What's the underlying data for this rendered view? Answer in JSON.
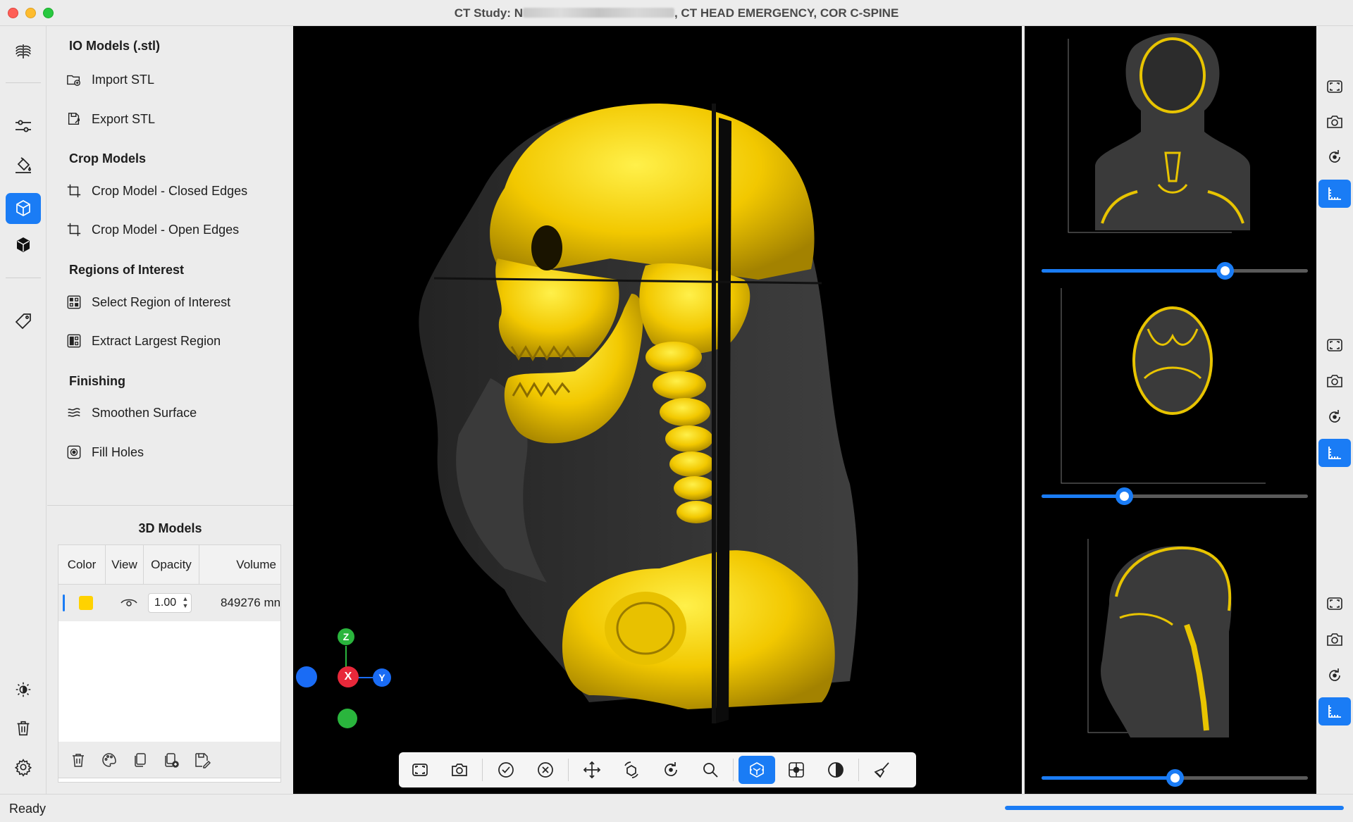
{
  "window": {
    "title_prefix": "CT Study: N",
    "title_suffix": ", CT  HEAD EMERGENCY, COR C-SPINE"
  },
  "tools": {
    "io_header": "IO Models (.stl)",
    "import_stl": "Import STL",
    "export_stl": "Export STL",
    "crop_header": "Crop Models",
    "crop_closed": "Crop Model - Closed Edges",
    "crop_open": "Crop Model - Open Edges",
    "roi_header": "Regions of Interest",
    "select_roi": "Select Region of Interest",
    "extract_largest": "Extract Largest Region",
    "finishing_header": "Finishing",
    "smoothen": "Smoothen Surface",
    "fill_holes": "Fill Holes"
  },
  "models": {
    "title": "3D Models",
    "columns": [
      "Color",
      "View",
      "Opacity",
      "Volume"
    ],
    "rows": [
      {
        "color": "#ffd200",
        "opacity": "1.00",
        "volume": "849276 mn"
      }
    ]
  },
  "axes": {
    "z": "Z",
    "x": "X",
    "y": "Y"
  },
  "slices": [
    {
      "name": "coronal",
      "position": 0.69
    },
    {
      "name": "axial",
      "position": 0.31
    },
    {
      "name": "sagittal",
      "position": 0.5
    }
  ],
  "status": {
    "text": "Ready",
    "progress": 1.0
  },
  "colors": {
    "accent": "#1a7cf5",
    "bone": "#ffd200"
  }
}
